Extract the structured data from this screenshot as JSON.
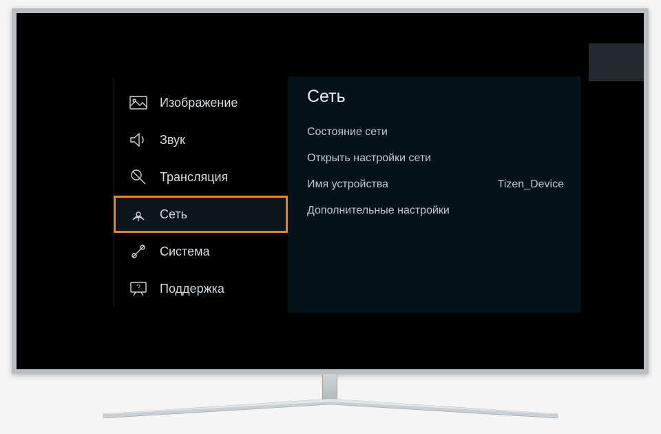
{
  "sidebar": {
    "items": [
      {
        "label": "Изображение",
        "icon": "picture-icon",
        "selected": false
      },
      {
        "label": "Звук",
        "icon": "sound-icon",
        "selected": false
      },
      {
        "label": "Трансляция",
        "icon": "broadcast-icon",
        "selected": false
      },
      {
        "label": "Сеть",
        "icon": "network-icon",
        "selected": true
      },
      {
        "label": "Система",
        "icon": "system-icon",
        "selected": false
      },
      {
        "label": "Поддержка",
        "icon": "support-icon",
        "selected": false
      }
    ]
  },
  "panel": {
    "title": "Сеть",
    "rows": [
      {
        "label": "Состояние сети",
        "value": ""
      },
      {
        "label": "Открыть настройки сети",
        "value": ""
      },
      {
        "label": "Имя устройства",
        "value": "Tizen_Device"
      },
      {
        "label": "Дополнительные настройки",
        "value": ""
      }
    ]
  }
}
